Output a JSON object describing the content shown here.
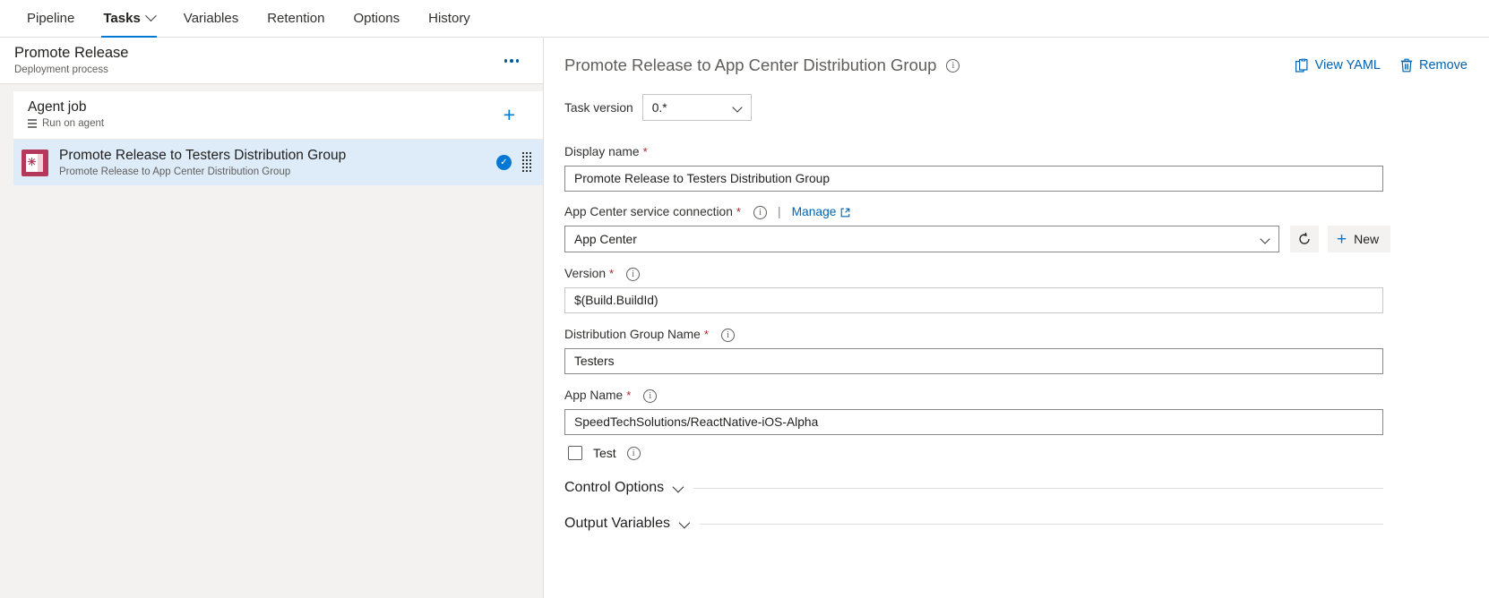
{
  "nav": {
    "tabs": [
      {
        "label": "Pipeline",
        "active": false,
        "caret": false
      },
      {
        "label": "Tasks",
        "active": true,
        "caret": true
      },
      {
        "label": "Variables",
        "active": false,
        "caret": false
      },
      {
        "label": "Retention",
        "active": false,
        "caret": false
      },
      {
        "label": "Options",
        "active": false,
        "caret": false
      },
      {
        "label": "History",
        "active": false,
        "caret": false
      }
    ]
  },
  "left_pane": {
    "process": {
      "title": "Promote Release",
      "subtitle": "Deployment process",
      "more_menu": "…"
    },
    "job": {
      "title": "Agent job",
      "subtitle": "Run on agent",
      "add_label": "+"
    },
    "task": {
      "title": "Promote Release to Testers Distribution Group",
      "subtitle": "Promote Release to App Center Distribution Group",
      "check": "✓",
      "icon_color": "#b4385c",
      "selected_bg": "#deecf9"
    }
  },
  "right_pane": {
    "title": "Promote Release to App Center Distribution Group",
    "actions": {
      "view_yaml": "View YAML",
      "remove": "Remove"
    },
    "task_version": {
      "label": "Task version",
      "value": "0.*"
    },
    "display_name": {
      "label": "Display name",
      "required": "*",
      "value": "Promote Release to Testers Distribution Group"
    },
    "service_connection": {
      "label": "App Center service connection",
      "required": "*",
      "manage_label": "Manage",
      "separator": "|",
      "value": "App Center",
      "refresh_title": "refresh",
      "new_label": "New"
    },
    "version": {
      "label": "Version",
      "required": "*",
      "value": "$(Build.BuildId)"
    },
    "distribution_group": {
      "label": "Distribution Group Name",
      "required": "*",
      "value": "Testers"
    },
    "app_name": {
      "label": "App Name",
      "required": "*",
      "value": "SpeedTechSolutions/ReactNative-iOS-Alpha"
    },
    "test": {
      "label": "Test",
      "checked": false
    },
    "sections": [
      {
        "label": "Control Options"
      },
      {
        "label": "Output Variables"
      }
    ]
  },
  "colors": {
    "accent": "#0078d4",
    "link": "#0063b1",
    "required": "#a4262c",
    "selected_row": "#deecf9",
    "panel_bg": "#f3f2f1"
  }
}
